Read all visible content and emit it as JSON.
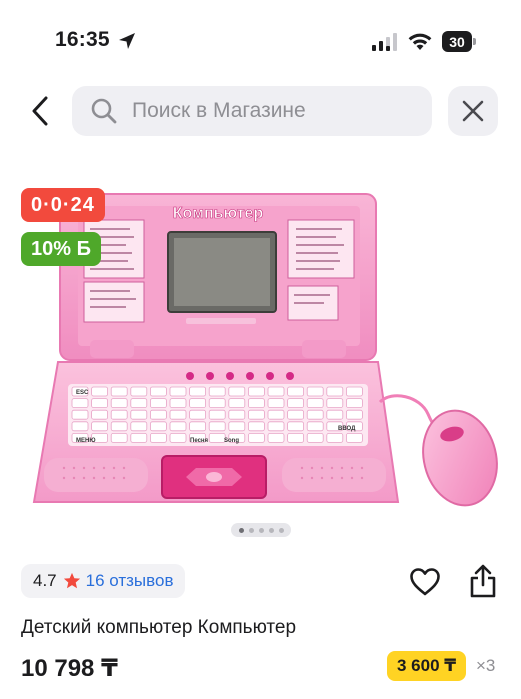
{
  "status_bar": {
    "time": "16:35",
    "battery": "30",
    "icons": [
      "location-arrow-icon",
      "cellular-signal-icon",
      "wifi-icon",
      "battery-icon"
    ]
  },
  "search": {
    "placeholder": "Поиск в Магазине",
    "icons": [
      "chevron-left-icon",
      "search-icon",
      "close-icon"
    ]
  },
  "product": {
    "timer": "0·0·24",
    "discount_badge": "10% Б",
    "image_labels": {
      "brand": "Компьютер",
      "keyboard_sample": [
        "ESC",
        "МЕНЮ",
        "Песня",
        "Song",
        "ВВОД"
      ]
    },
    "gallery": {
      "count": 5,
      "current": 1
    },
    "rating": "4.7",
    "reviews": "16 отзывов",
    "title": "Детский компьютер Компьютер",
    "price": "10 798 ₸",
    "installment_price": "3 600 ₸",
    "installment_months": "×3"
  },
  "colors": {
    "timer_badge": "#f24a3d",
    "discount_badge": "#4fa82a",
    "installment_badge": "#ffd323",
    "link": "#2a6fdb",
    "star": "#f24a3d",
    "laptop_pink": "#f7a6cf"
  }
}
